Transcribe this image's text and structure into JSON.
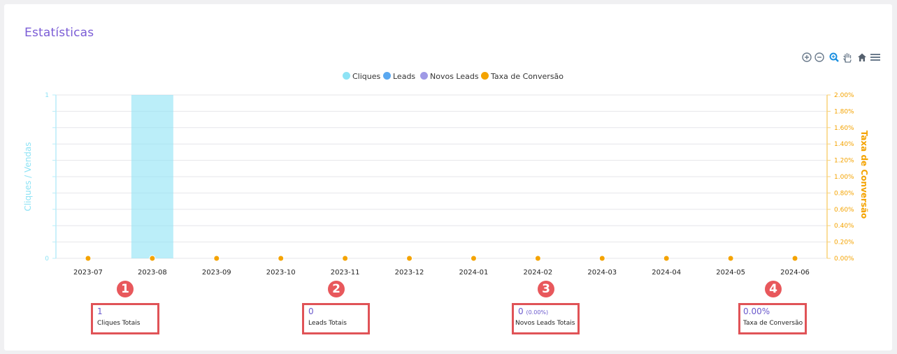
{
  "card": {
    "title": "Estatísticas"
  },
  "toolbar": [
    "zoom-in-icon",
    "zoom-out-icon",
    "selection-zoom-icon",
    "pan-icon",
    "reset-home-icon",
    "menu-icon"
  ],
  "legend": [
    {
      "label": "Cliques",
      "color": "#8ee3f5"
    },
    {
      "label": "Leads",
      "color": "#5aa8f0"
    },
    {
      "label": "Novos Leads",
      "color": "#9f9ae6"
    },
    {
      "label": "Taxa de Conversão",
      "color": "#f4a300"
    }
  ],
  "chart_data": {
    "type": "bar",
    "categories": [
      "2023-07",
      "2023-08",
      "2023-09",
      "2023-10",
      "2023-11",
      "2023-12",
      "2024-01",
      "2024-02",
      "2024-03",
      "2024-04",
      "2024-05",
      "2024-06"
    ],
    "series": [
      {
        "name": "Cliques",
        "type": "bar",
        "axis": "left",
        "values": [
          0,
          1,
          0,
          0,
          0,
          0,
          0,
          0,
          0,
          0,
          0,
          0
        ]
      },
      {
        "name": "Leads",
        "type": "bar",
        "axis": "left",
        "values": [
          0,
          0,
          0,
          0,
          0,
          0,
          0,
          0,
          0,
          0,
          0,
          0
        ]
      },
      {
        "name": "Novos Leads",
        "type": "bar",
        "axis": "left",
        "values": [
          0,
          0,
          0,
          0,
          0,
          0,
          0,
          0,
          0,
          0,
          0,
          0
        ]
      },
      {
        "name": "Taxa de Conversão",
        "type": "line",
        "axis": "right",
        "values": [
          0,
          0,
          0,
          0,
          0,
          0,
          0,
          0,
          0,
          0,
          0,
          0
        ]
      }
    ],
    "ylabel": "Cliques / Vendas",
    "ylim": [
      0,
      1
    ],
    "y_ticks": [
      "0",
      "1"
    ],
    "y2label": "Taxa de Conversão",
    "y2lim": [
      0,
      2
    ],
    "y2_ticks": [
      "0.00%",
      "0.20%",
      "0.40%",
      "0.60%",
      "0.80%",
      "1.00%",
      "1.20%",
      "1.40%",
      "1.60%",
      "1.80%",
      "2.00%"
    ],
    "grid": true,
    "legend_position": "top-center"
  },
  "stats": [
    {
      "marker": "1",
      "value": "1",
      "sub": "",
      "label": "Cliques Totais"
    },
    {
      "marker": "2",
      "value": "0",
      "sub": "",
      "label": "Leads Totais"
    },
    {
      "marker": "3",
      "value": "0",
      "sub": "(0.00%)",
      "label": "Novos Leads Totais"
    },
    {
      "marker": "4",
      "value": "0.00%",
      "sub": "",
      "label": "Taxa de Conversão"
    }
  ]
}
